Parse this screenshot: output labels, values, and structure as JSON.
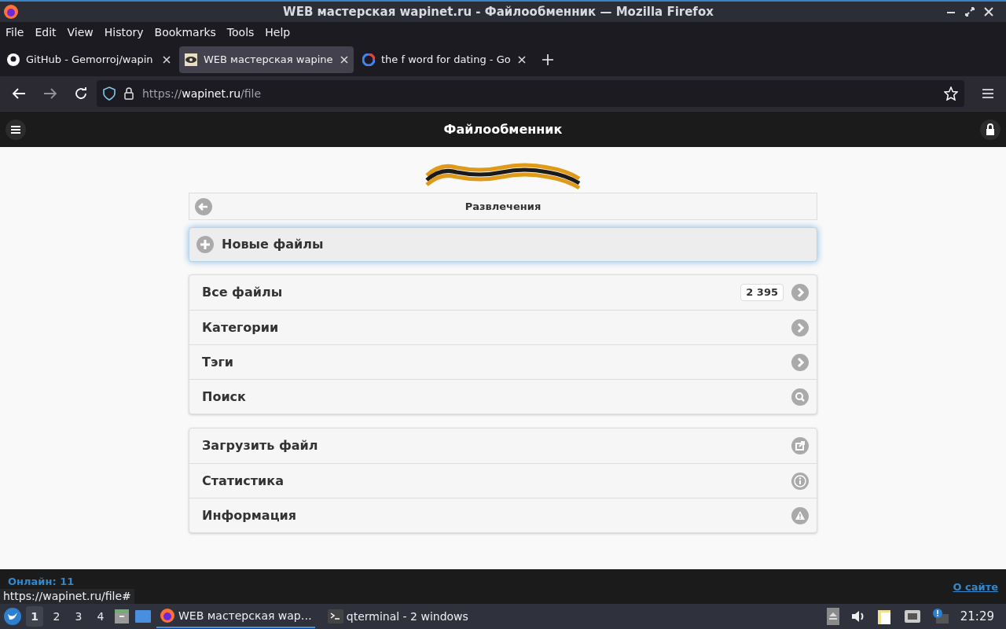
{
  "window": {
    "title": "WEB мастерская wapinet.ru - Файлообменник — Mozilla Firefox"
  },
  "menu": [
    "File",
    "Edit",
    "View",
    "History",
    "Bookmarks",
    "Tools",
    "Help"
  ],
  "tabs": [
    {
      "label": "GitHub - Gemorroj/wapin",
      "selected": false,
      "kind": "github"
    },
    {
      "label": "WEB мастерская wapine",
      "selected": true,
      "kind": "eye"
    },
    {
      "label": "the f word for dating - Go",
      "selected": false,
      "kind": "google"
    }
  ],
  "address": {
    "scheme": "https://",
    "host": "wapinet.ru",
    "path": "/file"
  },
  "page": {
    "header": "Файлообменник",
    "breadcrumb": "Развлечения",
    "highlight": "Новые файлы",
    "groups": [
      [
        {
          "label": "Все файлы",
          "count": "2 395",
          "kind": "link"
        },
        {
          "label": "Категории",
          "kind": "link"
        },
        {
          "label": "Тэги",
          "kind": "link"
        },
        {
          "label": "Поиск",
          "kind": "search"
        }
      ],
      [
        {
          "label": "Загрузить файл",
          "kind": "upload"
        },
        {
          "label": "Статистика",
          "kind": "info"
        },
        {
          "label": "Информация",
          "kind": "warning"
        }
      ]
    ],
    "online": "Онлайн: 11",
    "about": "О сайте"
  },
  "status_url": "https://wapinet.ru/file#",
  "taskbar": {
    "desktops": [
      {
        "label": "1",
        "selected": true
      },
      {
        "label": "2",
        "selected": false
      },
      {
        "label": "3",
        "selected": false
      },
      {
        "label": "4",
        "selected": false
      }
    ],
    "tasks": [
      {
        "label": "WEB мастерская wap…",
        "selected": true,
        "kind": "firefox"
      },
      {
        "label": "qterminal - 2 windows",
        "selected": false,
        "kind": "terminal"
      }
    ],
    "clock": "21:29"
  }
}
